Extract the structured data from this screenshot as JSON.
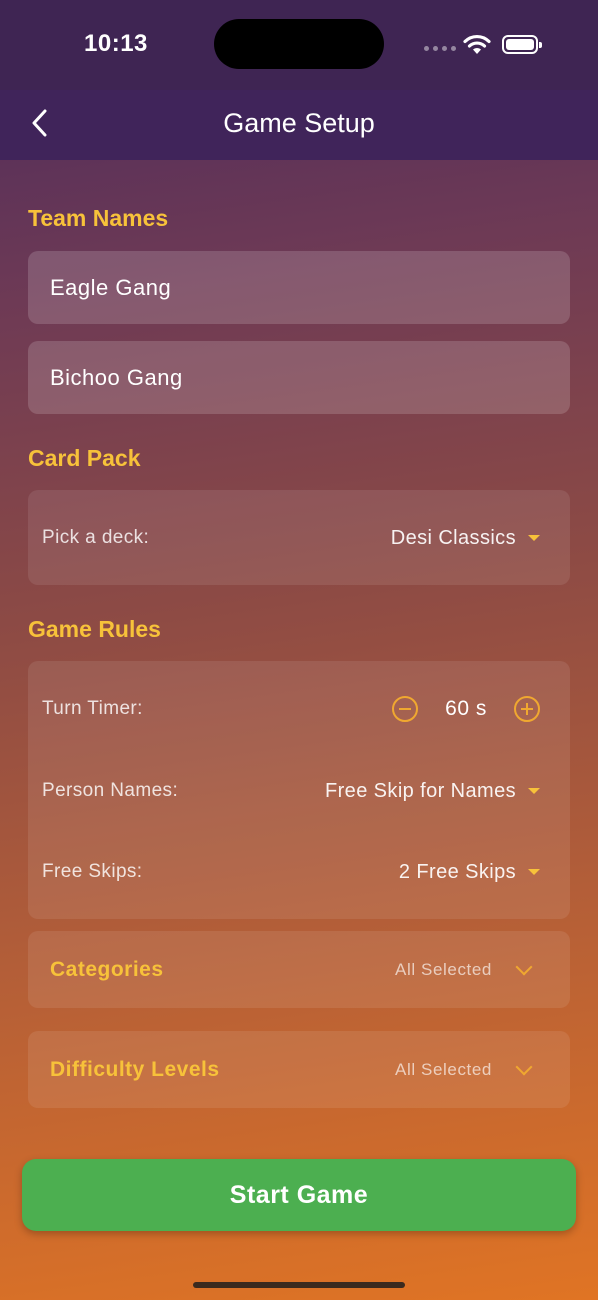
{
  "status_bar": {
    "time": "10:13"
  },
  "header": {
    "title": "Game Setup",
    "back_icon": "chevron-left-icon"
  },
  "team_names": {
    "title": "Team Names",
    "team1": "Eagle Gang",
    "team2": "Bichoo Gang"
  },
  "card_pack": {
    "title": "Card Pack",
    "label": "Pick a deck:",
    "value": "Desi Classics"
  },
  "game_rules": {
    "title": "Game Rules",
    "turn_timer_label": "Turn Timer:",
    "turn_timer_value": "60 s",
    "person_names_label": "Person Names:",
    "person_names_value": "Free Skip for Names",
    "free_skips_label": "Free Skips:",
    "free_skips_value": "2 Free Skips"
  },
  "categories": {
    "title": "Categories",
    "status": "All Selected"
  },
  "difficulty": {
    "title": "Difficulty Levels",
    "status": "All Selected"
  },
  "start_button": {
    "label": "Start Game"
  },
  "colors": {
    "accent": "#f7c23a",
    "start": "#4caf50",
    "header": "#40245a"
  }
}
